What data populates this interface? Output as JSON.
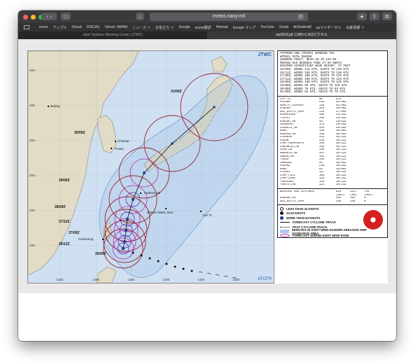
{
  "browser": {
    "url": "metoc.navy.mil",
    "bookmarks": [
      "mone",
      "アップル",
      "iCloud",
      "DISCAS",
      "Yahoo! JAPAN",
      "ニュース ∨",
      "お役立ち ∨",
      "Google",
      "excite翻訳",
      "Hotmail",
      "Google マップ",
      "YouTube",
      "Gmail",
      "AirStationM",
      "auマイポータル",
      "出産情報 ∨"
    ],
    "tabs": [
      {
        "label": "Joint Typhoon Warning Center (JTWC)",
        "active": false
      },
      {
        "label": "wp2818.gif 1,580×1,061ピクセル",
        "active": true
      }
    ]
  },
  "map": {
    "top_right_label": "JTWC",
    "bottom_right_label": "ATCF®",
    "lat_labels": [
      "45N",
      "40N",
      "35N",
      "30N",
      "25N",
      "20N"
    ],
    "lon_labels": [
      "125E",
      "130E",
      "135E",
      "140E",
      "145E",
      "150E"
    ],
    "place_labels": {
      "beijing": "Beijing",
      "pusan": "Pusan",
      "chinhae": "Chinhae",
      "kadena": "Kadena AB",
      "minami": "Minami Daito Jima",
      "iwo": "Iwo To",
      "kaohsiung": "Kaohsiung"
    },
    "forecast_times": [
      "01/00Z",
      "30/00Z",
      "29/00Z",
      "28/00Z",
      "27/12Z",
      "27/00Z",
      "26/12Z",
      "26/00Z"
    ],
    "colors": {
      "danger_area": "#a9c8ea",
      "radius_34kt": "#9a2430",
      "radius_50kt": "#b02aa8",
      "radius_64kt": "#5a30b0",
      "track": "#222222"
    }
  },
  "warning": {
    "lines": [
      "TYPHOON 28W (TRAMI) WARNING #31",
      "WTPN31 PGTW 260300",
      "260000Z POSIT: NEAR 20.7N 129.0E",
      "MOVING 015 DEGREES TRUE AT 04 KNOTS",
      "MAXIMUM SIGNIFICANT WAVE HEIGHT: 37 FEET",
      "26/00Z, WINDS 115 KTS, GUSTS TO 140 KTS",
      "26/12Z, WINDS 105 KTS, GUSTS TO 130 KTS",
      "27/00Z, WINDS 100 KTS, GUSTS TO 125 KTS",
      "27/12Z, WINDS 100 KTS, GUSTS TO 125 KTS",
      "28/00Z, WINDS 100 KTS, GUSTS TO 125 KTS",
      "29/00Z, WINDS 90 KTS, GUSTS TO 110 KTS",
      "30/00Z, WINDS 70 KTS, GUSTS TO 85 KTS",
      "01/00Z, WINDS 55 KTS, GUSTS TO 70 KTS"
    ]
  },
  "cpa": {
    "headers": [
      "CPA TO:",
      "NM",
      "DTG"
    ],
    "rows": [
      [
        "MISAWA",
        "219",
        "01/00Z"
      ],
      [
        "NARITA_AIRPORT",
        "136",
        "01/00Z"
      ],
      [
        "SASEBO",
        "203",
        "30/00Z"
      ],
      [
        "OKI_DAITO_JIMA",
        "219",
        "27/09Z"
      ],
      [
        "KAOHSIUNG",
        "364",
        "26/15Z"
      ],
      [
        "TAIPEI",
        "266",
        "29/03Z"
      ],
      [
        "KADENA_AB",
        "58",
        "29/03Z"
      ],
      [
        "SHANGHAI",
        "374",
        "29/18Z"
      ],
      [
        "CHANGJU_AB",
        "316",
        "30/08Z"
      ],
      [
        "NAHA",
        "130",
        "30/08Z"
      ],
      [
        "KUNSAN_AB",
        "356",
        "30/09Z"
      ],
      [
        "CHINHAE",
        "251",
        "30/12Z"
      ],
      [
        "PUSAN",
        "233",
        "30/12Z"
      ],
      [
        "CAMP_HUMPHREYS",
        "385",
        "30/12Z"
      ],
      [
        "CHEONGJU_AB",
        "395",
        "30/12Z"
      ],
      [
        "OSAN_AB",
        "389",
        "30/12Z"
      ],
      [
        "KWANGJU_AB",
        "397",
        "30/12Z"
      ],
      [
        "SUWON_AB",
        "391",
        "30/12Z"
      ],
      [
        "TAEGU",
        "254",
        "30/12Z"
      ],
      [
        "IWAKUNI",
        "95",
        "30/09Z"
      ],
      [
        "PUSAN2",
        "239",
        "30/15Z"
      ],
      [
        "KURE",
        "85",
        "30/09Z"
      ],
      [
        "ATSUGI",
        "117",
        "30/12Z"
      ],
      [
        "CAMP_FUJI",
        "102",
        "30/22Z"
      ],
      [
        "CAMP_ZAMA",
        "115",
        "30/22Z"
      ],
      [
        "YOKOSUKA",
        "129",
        "30/23Z"
      ],
      [
        "YOKOTA_AB",
        "121",
        "30/23Z"
      ]
    ]
  },
  "bearing": {
    "headers": [
      "BEARING AND DISTANCE",
      "DIR",
      "DIST",
      "TAU"
    ],
    "units": [
      "",
      "(DEG)",
      "(NM)",
      "(HRS)"
    ],
    "rows": [
      [
        "KADENA_AB",
        "169",
        "354",
        "0"
      ],
      [
        "OKI_DAITO_JIMA",
        "209",
        "259",
        "0"
      ]
    ]
  },
  "legend": {
    "items": [
      "LESS THAN 34 KNOTS",
      "34-63 KNOTS",
      "MORE THAN 63 KNOTS",
      "FORECAST CYCLONE TRACK",
      "PAST CYCLONE TRACK",
      "DENOTES 34 KNOT WIND DANGER AREA/USN SHIP AVOIDANCE AREA",
      "FORECAST 34/50/64 KNOT WIND RADII"
    ]
  }
}
